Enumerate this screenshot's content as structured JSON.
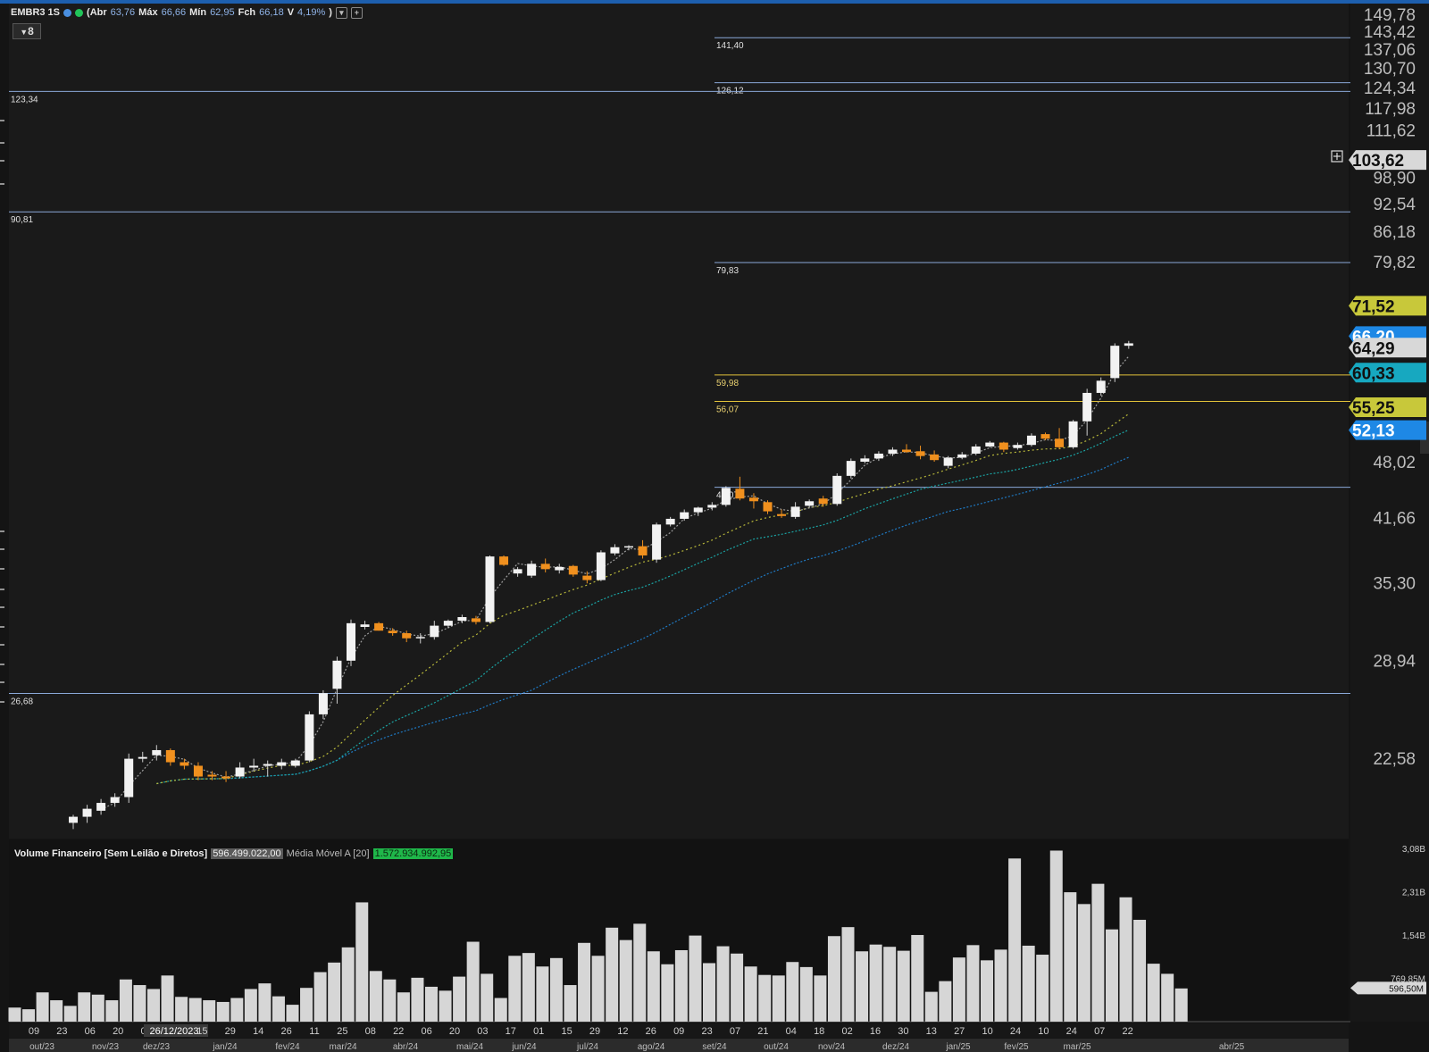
{
  "header": {
    "symbol": "EMBR3 1S",
    "open_label": "(Abr",
    "open": "63,76",
    "high_label": "Máx",
    "high": "66,66",
    "low_label": "Mín",
    "low": "62,95",
    "close_label": "Fch",
    "close": "66,18",
    "var_label": "V",
    "var": "4,19%",
    "close_paren": ")"
  },
  "tool_label": "8",
  "colors": {
    "background": "#141414",
    "up_candle": "#f2f2f2",
    "down_candle": "#f0901e",
    "level_line_blue": "#8aa8d8",
    "level_line_yellow": "#e2c23a",
    "ma_yellow": "#b8b83a",
    "ma_teal": "#1aa3a3",
    "ma_blue": "#1f7ac4"
  },
  "chart_data": {
    "type": "candlestick",
    "y_ticks": [
      "149,78",
      "143,42",
      "137,06",
      "130,70",
      "124,34",
      "117,98",
      "111,62",
      "98,90",
      "92,54",
      "86,18",
      "79,82",
      "48,02",
      "41,66",
      "35,30",
      "28,94",
      "22,58"
    ],
    "y_scale": "log",
    "x_day_ticks": [
      "09",
      "23",
      "06",
      "20",
      "04",
      "26/12/2023",
      "15",
      "29",
      "14",
      "26",
      "11",
      "25",
      "08",
      "22",
      "06",
      "20",
      "03",
      "17",
      "01",
      "15",
      "29",
      "12",
      "26",
      "09",
      "23",
      "07",
      "21",
      "04",
      "18",
      "02",
      "16",
      "30",
      "13",
      "27",
      "10",
      "24",
      "10",
      "24",
      "07",
      "22"
    ],
    "x_month_ticks": [
      "out/23",
      "nov/23",
      "dez/23",
      "jan/24",
      "fev/24",
      "mar/24",
      "abr/24",
      "mai/24",
      "jun/24",
      "jul/24",
      "ago/24",
      "set/24",
      "out/24",
      "nov/24",
      "dez/24",
      "jan/25",
      "fev/25",
      "mar/25",
      "abr/25"
    ],
    "horizontal_levels": [
      {
        "label": "141,40",
        "value": 141.4,
        "color": "blue"
      },
      {
        "label": "126,12",
        "value": 126.12,
        "color": "blue"
      },
      {
        "label": "123,34",
        "value": 123.34,
        "color": "blue"
      },
      {
        "label": "90,81",
        "value": 90.81,
        "color": "blue"
      },
      {
        "label": "79,83",
        "value": 79.83,
        "color": "blue"
      },
      {
        "label": "59,98",
        "value": 59.98,
        "color": "yellow"
      },
      {
        "label": "56,07",
        "value": 56.07,
        "color": "yellow"
      },
      {
        "label": "45,07",
        "value": 45.07,
        "color": "blue"
      },
      {
        "label": "26,68",
        "value": 26.68,
        "color": "blue"
      }
    ],
    "price_tags": [
      {
        "label": "103,62",
        "value": 103.62,
        "color": "#d8d8d8"
      },
      {
        "label": "71,52",
        "value": 71.52,
        "color": "#c8c83a"
      },
      {
        "label": "66,20",
        "value": 66.2,
        "color": "#1e88e5"
      },
      {
        "label": "64,29",
        "value": 64.29,
        "color": "#d8d8d8"
      },
      {
        "label": "60,33",
        "value": 60.33,
        "color": "#17a8c0"
      },
      {
        "label": "55,25",
        "value": 55.25,
        "color": "#c8c83a"
      },
      {
        "label": "52,13",
        "value": 52.13,
        "color": "#1e88e5"
      }
    ],
    "candles": [
      {
        "o": 19.2,
        "h": 19.6,
        "l": 18.9,
        "c": 19.5
      },
      {
        "o": 19.5,
        "h": 20.1,
        "l": 19.2,
        "c": 19.9
      },
      {
        "o": 19.8,
        "h": 20.4,
        "l": 19.6,
        "c": 20.2
      },
      {
        "o": 20.2,
        "h": 20.7,
        "l": 20.0,
        "c": 20.5
      },
      {
        "o": 20.5,
        "h": 22.9,
        "l": 20.2,
        "c": 22.6
      },
      {
        "o": 22.6,
        "h": 23.0,
        "l": 22.4,
        "c": 22.7
      },
      {
        "o": 22.8,
        "h": 23.4,
        "l": 22.5,
        "c": 23.1
      },
      {
        "o": 23.1,
        "h": 23.2,
        "l": 22.2,
        "c": 22.4
      },
      {
        "o": 22.4,
        "h": 22.6,
        "l": 22.0,
        "c": 22.2
      },
      {
        "o": 22.2,
        "h": 22.4,
        "l": 21.4,
        "c": 21.6
      },
      {
        "o": 21.7,
        "h": 21.9,
        "l": 21.4,
        "c": 21.6
      },
      {
        "o": 21.6,
        "h": 21.9,
        "l": 21.3,
        "c": 21.5
      },
      {
        "o": 21.6,
        "h": 22.4,
        "l": 21.5,
        "c": 22.1
      },
      {
        "o": 22.1,
        "h": 22.6,
        "l": 21.9,
        "c": 22.2
      },
      {
        "o": 22.2,
        "h": 22.5,
        "l": 21.6,
        "c": 22.3
      },
      {
        "o": 22.2,
        "h": 22.6,
        "l": 22.0,
        "c": 22.4
      },
      {
        "o": 22.2,
        "h": 22.6,
        "l": 22.1,
        "c": 22.5
      },
      {
        "o": 22.5,
        "h": 25.5,
        "l": 22.4,
        "c": 25.3
      },
      {
        "o": 25.3,
        "h": 26.9,
        "l": 25.0,
        "c": 26.7
      },
      {
        "o": 27.0,
        "h": 29.3,
        "l": 26.0,
        "c": 29.0
      },
      {
        "o": 29.0,
        "h": 32.2,
        "l": 28.6,
        "c": 31.9
      },
      {
        "o": 31.6,
        "h": 32.1,
        "l": 31.4,
        "c": 31.8
      },
      {
        "o": 31.9,
        "h": 32.0,
        "l": 31.3,
        "c": 31.3
      },
      {
        "o": 31.3,
        "h": 31.5,
        "l": 30.9,
        "c": 31.1
      },
      {
        "o": 31.1,
        "h": 31.3,
        "l": 30.4,
        "c": 30.7
      },
      {
        "o": 30.7,
        "h": 31.1,
        "l": 30.3,
        "c": 30.8
      },
      {
        "o": 30.8,
        "h": 32.1,
        "l": 30.6,
        "c": 31.7
      },
      {
        "o": 31.7,
        "h": 32.2,
        "l": 31.5,
        "c": 32.1
      },
      {
        "o": 32.1,
        "h": 32.6,
        "l": 31.9,
        "c": 32.4
      },
      {
        "o": 32.3,
        "h": 32.5,
        "l": 31.8,
        "c": 32.0
      },
      {
        "o": 32.0,
        "h": 37.9,
        "l": 31.9,
        "c": 37.8
      },
      {
        "o": 37.8,
        "h": 37.9,
        "l": 36.9,
        "c": 37.0
      },
      {
        "o": 36.2,
        "h": 36.8,
        "l": 35.9,
        "c": 36.6
      },
      {
        "o": 36.0,
        "h": 37.4,
        "l": 35.8,
        "c": 37.1
      },
      {
        "o": 37.1,
        "h": 37.6,
        "l": 36.3,
        "c": 36.6
      },
      {
        "o": 36.5,
        "h": 37.1,
        "l": 36.2,
        "c": 36.8
      },
      {
        "o": 36.9,
        "h": 37.0,
        "l": 35.9,
        "c": 36.1
      },
      {
        "o": 36.0,
        "h": 36.4,
        "l": 35.3,
        "c": 35.6
      },
      {
        "o": 35.6,
        "h": 38.4,
        "l": 35.5,
        "c": 38.2
      },
      {
        "o": 38.1,
        "h": 39.0,
        "l": 37.9,
        "c": 38.7
      },
      {
        "o": 38.7,
        "h": 38.9,
        "l": 38.4,
        "c": 38.8
      },
      {
        "o": 38.8,
        "h": 39.4,
        "l": 37.6,
        "c": 37.9
      },
      {
        "o": 37.5,
        "h": 41.2,
        "l": 37.2,
        "c": 41.0
      },
      {
        "o": 41.0,
        "h": 41.8,
        "l": 40.8,
        "c": 41.6
      },
      {
        "o": 41.6,
        "h": 42.6,
        "l": 41.4,
        "c": 42.3
      },
      {
        "o": 42.3,
        "h": 42.9,
        "l": 41.9,
        "c": 42.8
      },
      {
        "o": 42.8,
        "h": 43.4,
        "l": 42.5,
        "c": 43.1
      },
      {
        "o": 43.1,
        "h": 45.2,
        "l": 42.9,
        "c": 45.0
      },
      {
        "o": 44.9,
        "h": 46.3,
        "l": 43.6,
        "c": 43.8
      },
      {
        "o": 43.9,
        "h": 44.4,
        "l": 42.7,
        "c": 43.5
      },
      {
        "o": 43.4,
        "h": 43.6,
        "l": 42.1,
        "c": 42.4
      },
      {
        "o": 42.1,
        "h": 42.6,
        "l": 41.7,
        "c": 41.9
      },
      {
        "o": 41.8,
        "h": 43.4,
        "l": 41.6,
        "c": 42.9
      },
      {
        "o": 43.0,
        "h": 43.7,
        "l": 42.8,
        "c": 43.5
      },
      {
        "o": 43.8,
        "h": 44.1,
        "l": 42.9,
        "c": 43.2
      },
      {
        "o": 43.2,
        "h": 46.7,
        "l": 43.0,
        "c": 46.4
      },
      {
        "o": 46.4,
        "h": 48.5,
        "l": 46.1,
        "c": 48.2
      },
      {
        "o": 48.1,
        "h": 48.9,
        "l": 47.9,
        "c": 48.5
      },
      {
        "o": 48.5,
        "h": 49.4,
        "l": 48.2,
        "c": 49.1
      },
      {
        "o": 49.1,
        "h": 49.9,
        "l": 48.8,
        "c": 49.6
      },
      {
        "o": 49.6,
        "h": 50.3,
        "l": 49.2,
        "c": 49.3
      },
      {
        "o": 49.4,
        "h": 50.1,
        "l": 48.4,
        "c": 48.8
      },
      {
        "o": 49.0,
        "h": 49.5,
        "l": 48.1,
        "c": 48.3
      },
      {
        "o": 47.6,
        "h": 48.8,
        "l": 47.3,
        "c": 48.6
      },
      {
        "o": 48.6,
        "h": 49.3,
        "l": 48.4,
        "c": 49.0
      },
      {
        "o": 49.1,
        "h": 50.3,
        "l": 48.9,
        "c": 50.0
      },
      {
        "o": 50.0,
        "h": 50.7,
        "l": 49.9,
        "c": 50.5
      },
      {
        "o": 50.5,
        "h": 50.6,
        "l": 49.3,
        "c": 49.6
      },
      {
        "o": 49.8,
        "h": 50.5,
        "l": 49.6,
        "c": 50.2
      },
      {
        "o": 50.2,
        "h": 51.7,
        "l": 50.0,
        "c": 51.4
      },
      {
        "o": 51.6,
        "h": 51.8,
        "l": 50.8,
        "c": 51.0
      },
      {
        "o": 51.0,
        "h": 52.4,
        "l": 49.7,
        "c": 49.9
      },
      {
        "o": 49.9,
        "h": 53.5,
        "l": 49.7,
        "c": 53.3
      },
      {
        "o": 53.3,
        "h": 57.9,
        "l": 51.4,
        "c": 57.3
      },
      {
        "o": 57.3,
        "h": 59.6,
        "l": 56.9,
        "c": 59.1
      },
      {
        "o": 59.5,
        "h": 65.0,
        "l": 58.9,
        "c": 64.6
      },
      {
        "o": 64.6,
        "h": 65.4,
        "l": 64.1,
        "c": 65.0
      }
    ],
    "volume_series": {
      "name": "Volume Financeiro [Sem Leilão e Diretos]",
      "current_label": "596.499.022,00",
      "ma_name": "Média Móvel A [20]",
      "ma_label": "1.572.934.992,95",
      "y_ticks": [
        "3,08B",
        "2,31B",
        "1,54B",
        "769,85M"
      ],
      "tags": [
        {
          "label": "596,50M",
          "value": 0.5965
        }
      ],
      "values_b": [
        0.25,
        0.22,
        0.52,
        0.38,
        0.28,
        0.52,
        0.48,
        0.38,
        0.75,
        0.65,
        0.58,
        0.82,
        0.44,
        0.42,
        0.38,
        0.35,
        0.42,
        0.58,
        0.68,
        0.45,
        0.3,
        0.6,
        0.88,
        1.05,
        1.32,
        2.12,
        0.9,
        0.75,
        0.52,
        0.78,
        0.62,
        0.55,
        0.8,
        1.42,
        0.85,
        0.42,
        1.17,
        1.22,
        0.98,
        1.13,
        0.65,
        1.4,
        1.17,
        1.67,
        1.45,
        1.74,
        1.25,
        1.02,
        1.27,
        1.53,
        1.04,
        1.34,
        1.21,
        0.98,
        0.83,
        0.82,
        1.06,
        0.97,
        0.82,
        1.52,
        1.68,
        1.25,
        1.37,
        1.33,
        1.26,
        1.54,
        0.53,
        0.72,
        1.14,
        1.36,
        1.09,
        1.28,
        2.9,
        1.35,
        1.19,
        3.04,
        2.3,
        2.09,
        2.45,
        1.64,
        2.21,
        1.81,
        1.03,
        0.85,
        0.59
      ]
    }
  }
}
